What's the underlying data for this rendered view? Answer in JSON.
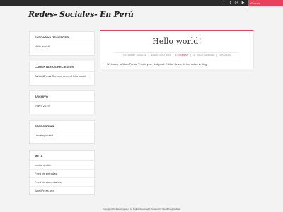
{
  "topbar": {
    "social_icons": [
      "facebook-icon",
      "twitter-icon",
      "google-plus-icon",
      "youtube-icon"
    ],
    "social_glyphs": [
      "f",
      "t",
      "g+",
      "▶"
    ],
    "search_placeholder": "Search"
  },
  "site_title": "Redes- Sociales- En Perú",
  "sidebar": {
    "recent_posts": {
      "title": "ENTRADAS RECIENTES",
      "items": [
        "Hello world!"
      ]
    },
    "recent_comments": {
      "title": "COMENTARIOS RECIENTES",
      "items": [
        "A WordPress Commenter en Hello world!"
      ]
    },
    "archive": {
      "title": "ARCHIVO",
      "items": [
        "Enero 2019"
      ]
    },
    "categories": {
      "title": "CATEGORÍAS",
      "items": [
        "Uncategorized"
      ]
    },
    "meta": {
      "title": "META",
      "items": [
        "Iniciar sesión",
        "Feed de entradas",
        "Feed de comentarios",
        "WordPress.org"
      ]
    }
  },
  "post": {
    "title": "Hello world!",
    "meta": {
      "author": "POSTED BY: CHARLES",
      "date": "ENERO 29TH, 2019",
      "comments": "1 COMMENT",
      "category": "IN: UNCATEGORIZED",
      "views": "256 VIEWS"
    },
    "body": "Welcome to WordPress. This is your first post. Edit or delete it, then start writing!"
  },
  "footer": "Copyright 2013 Hemingway | All Rights Reserved | Powered by WordPress | Bdaph",
  "colors": {
    "accent": "#e8415d",
    "topbar": "#2b2b2b",
    "background": "#f3f3f3"
  }
}
